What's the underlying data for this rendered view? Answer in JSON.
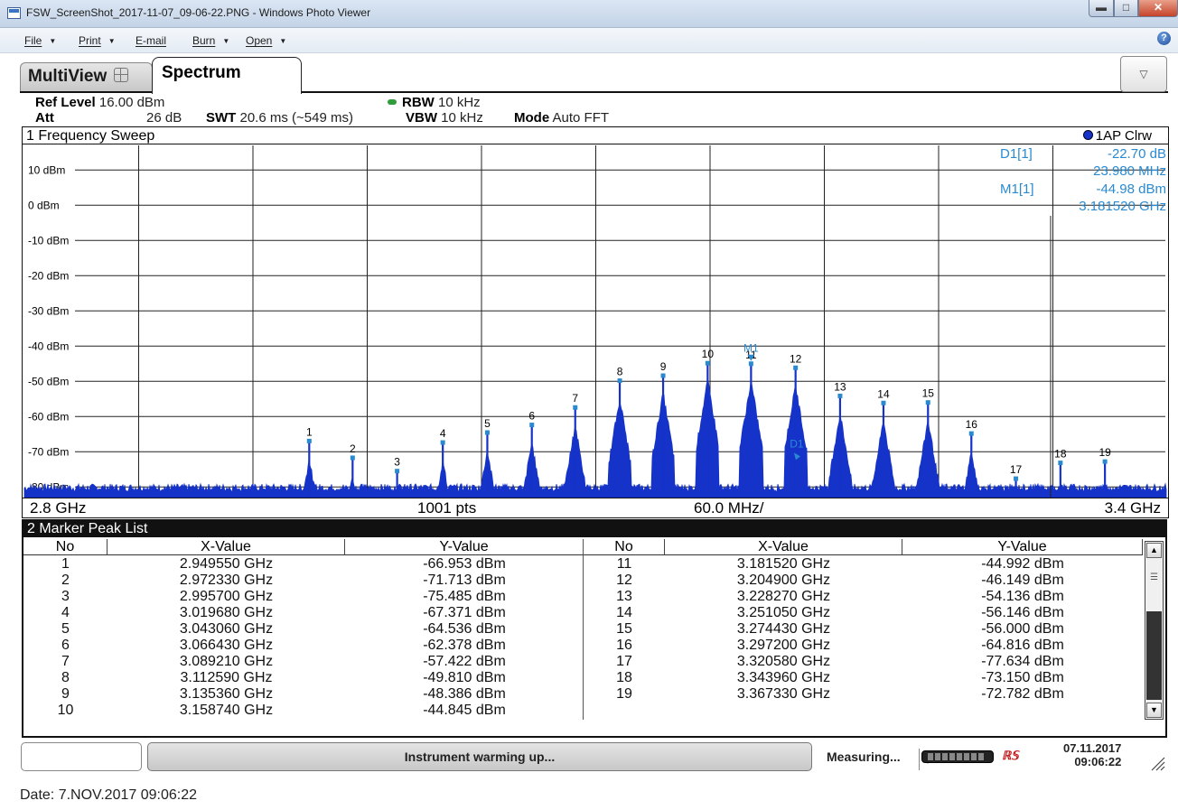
{
  "window": {
    "title": "FSW_ScreenShot_2017-11-07_09-06-22.PNG - Windows Photo Viewer",
    "buttons": {
      "minimize": "▬",
      "maximize": "□",
      "close": "✕"
    }
  },
  "menu": {
    "items": [
      {
        "label": "File",
        "has_caret": true
      },
      {
        "label": "Print",
        "has_caret": true
      },
      {
        "label": "E-mail",
        "has_caret": false
      },
      {
        "label": "Burn",
        "has_caret": true
      },
      {
        "label": "Open",
        "has_caret": true
      }
    ],
    "help": "?"
  },
  "instrument": {
    "tabs": {
      "multiview": "MultiView",
      "spectrum": "Spectrum"
    },
    "dropdown": "▽",
    "settings": {
      "ref_level_label": "Ref Level",
      "ref_level_value": "16.00 dBm",
      "att_label": "Att",
      "att_value": "26 dB",
      "swt_label": "SWT",
      "swt_value": "20.6 ms (~549 ms)",
      "rbw_label": "RBW",
      "rbw_value": "10 kHz",
      "vbw_label": "VBW",
      "vbw_value": "10 kHz",
      "mode_label": "Mode",
      "mode_value": "Auto FFT"
    },
    "diagram": {
      "title": "1 Frequency Sweep",
      "trace_legend": "1AP Clrw",
      "marker_info": {
        "d1_label": "D1[1]",
        "d1_value": "-22.70 dB",
        "d1_freq": "23.980 MHz",
        "m1_label": "M1[1]",
        "m1_value": "-44.98 dBm",
        "m1_freq": "3.181520 GHz"
      },
      "footer": {
        "start": "2.8 GHz",
        "points": "1001 pts",
        "span_per_div": "60.0 MHz/",
        "stop": "3.4 GHz"
      }
    },
    "peak_list": {
      "title": "2 Marker Peak List",
      "columns": [
        "No",
        "X-Value",
        "Y-Value"
      ]
    },
    "status": {
      "message": "Instrument warming up...",
      "spin": "⇕",
      "measuring": "Measuring...",
      "logo": "ℝ𝕊",
      "date": "07.11.2017",
      "time": "09:06:22"
    }
  },
  "footer_date": "Date: 7.NOV.2017  09:06:22",
  "colors": {
    "trace": "#1533c9",
    "marker": "#2a8ad0",
    "grid": "#222222"
  },
  "chart_data": {
    "type": "line",
    "title": "1 Frequency Sweep",
    "xlabel": "",
    "ylabel": "",
    "xlim": [
      2.8,
      3.4
    ],
    "x_unit": "GHz",
    "ylim": [
      -83,
      17
    ],
    "yticks": [
      10,
      0,
      -10,
      -20,
      -30,
      -40,
      -50,
      -60,
      -70,
      -80
    ],
    "ytick_labels": [
      "10 dBm",
      "0 dBm",
      "-10 dBm",
      "-20 dBm",
      "-30 dBm",
      "-40 dBm",
      "-50 dBm",
      "-60 dBm",
      "-70 dBm",
      "-80 dBm"
    ],
    "x_divisions": 10,
    "grid": true,
    "noise_floor_dbm": -80,
    "delta_marker": {
      "label": "D1",
      "x": 3.2055,
      "y": -67.7
    },
    "ref_marker": {
      "label": "M1",
      "x": 3.18152,
      "y": -44.98
    },
    "peaks": [
      {
        "no": "1",
        "x": 2.94955,
        "x_text": "2.949550 GHz",
        "y": -66.953,
        "y_text": "-66.953 dBm"
      },
      {
        "no": "2",
        "x": 2.97233,
        "x_text": "2.972330 GHz",
        "y": -71.713,
        "y_text": "-71.713 dBm"
      },
      {
        "no": "3",
        "x": 2.9957,
        "x_text": "2.995700 GHz",
        "y": -75.485,
        "y_text": "-75.485 dBm"
      },
      {
        "no": "4",
        "x": 3.01968,
        "x_text": "3.019680 GHz",
        "y": -67.371,
        "y_text": "-67.371 dBm"
      },
      {
        "no": "5",
        "x": 3.04306,
        "x_text": "3.043060 GHz",
        "y": -64.536,
        "y_text": "-64.536 dBm"
      },
      {
        "no": "6",
        "x": 3.06643,
        "x_text": "3.066430 GHz",
        "y": -62.378,
        "y_text": "-62.378 dBm"
      },
      {
        "no": "7",
        "x": 3.08921,
        "x_text": "3.089210 GHz",
        "y": -57.422,
        "y_text": "-57.422 dBm"
      },
      {
        "no": "8",
        "x": 3.11259,
        "x_text": "3.112590 GHz",
        "y": -49.81,
        "y_text": "-49.810 dBm"
      },
      {
        "no": "9",
        "x": 3.13536,
        "x_text": "3.135360 GHz",
        "y": -48.386,
        "y_text": "-48.386 dBm"
      },
      {
        "no": "10",
        "x": 3.15874,
        "x_text": "3.158740 GHz",
        "y": -44.845,
        "y_text": "-44.845 dBm"
      },
      {
        "no": "11",
        "x": 3.18152,
        "x_text": "3.181520 GHz",
        "y": -44.992,
        "y_text": "-44.992 dBm"
      },
      {
        "no": "12",
        "x": 3.2049,
        "x_text": "3.204900 GHz",
        "y": -46.149,
        "y_text": "-46.149 dBm"
      },
      {
        "no": "13",
        "x": 3.22827,
        "x_text": "3.228270 GHz",
        "y": -54.136,
        "y_text": "-54.136 dBm"
      },
      {
        "no": "14",
        "x": 3.25105,
        "x_text": "3.251050 GHz",
        "y": -56.146,
        "y_text": "-56.146 dBm"
      },
      {
        "no": "15",
        "x": 3.27443,
        "x_text": "3.274430 GHz",
        "y": -56.0,
        "y_text": "-56.000 dBm"
      },
      {
        "no": "16",
        "x": 3.2972,
        "x_text": "3.297200 GHz",
        "y": -64.816,
        "y_text": "-64.816 dBm"
      },
      {
        "no": "17",
        "x": 3.32058,
        "x_text": "3.320580 GHz",
        "y": -77.634,
        "y_text": "-77.634 dBm"
      },
      {
        "no": "18",
        "x": 3.34396,
        "x_text": "3.343960 GHz",
        "y": -73.15,
        "y_text": "-73.150 dBm"
      },
      {
        "no": "19",
        "x": 3.36733,
        "x_text": "3.367330 GHz",
        "y": -72.782,
        "y_text": "-72.782 dBm"
      }
    ]
  }
}
